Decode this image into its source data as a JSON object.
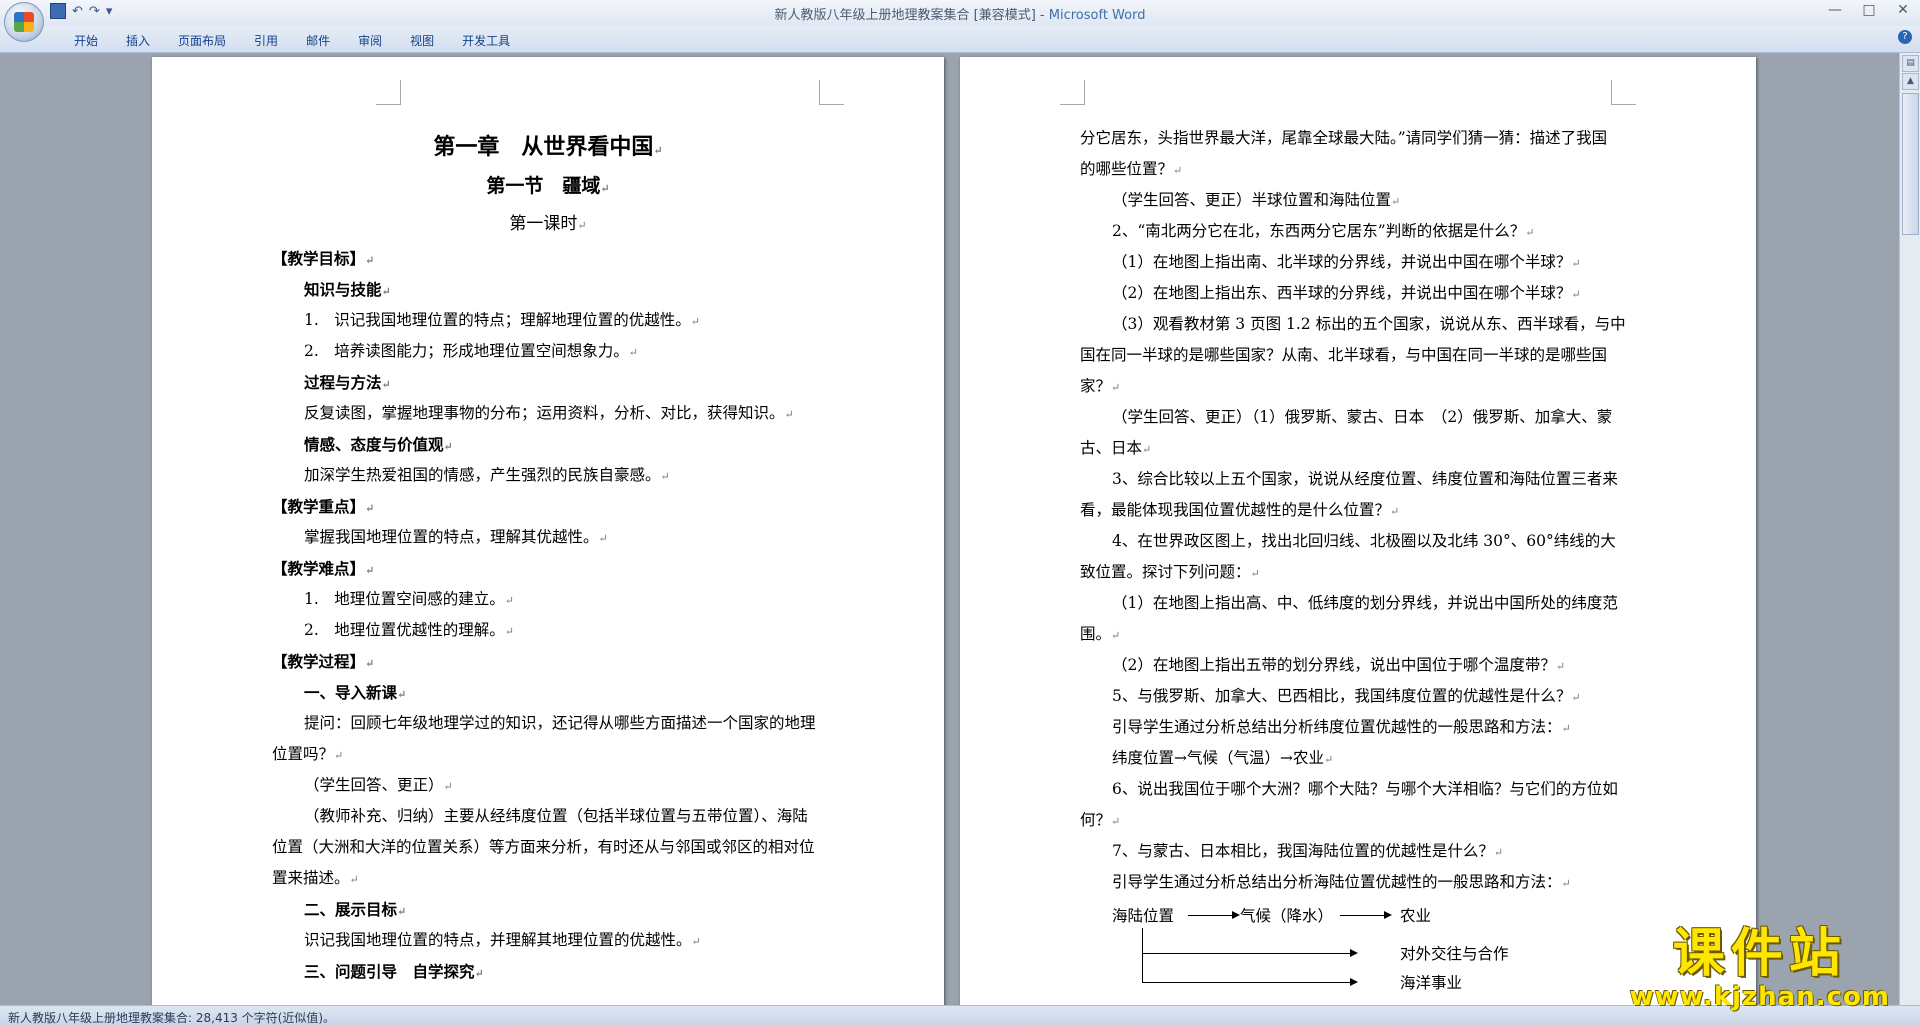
{
  "window": {
    "title": "新人教版八年级上册地理教案集合 [兼容模式] - ",
    "app_name": "Microsoft Word",
    "controls": [
      "—",
      "□",
      "✕"
    ]
  },
  "ribbon": {
    "tabs": [
      "开始",
      "插入",
      "页面布局",
      "引用",
      "邮件",
      "审阅",
      "视图",
      "开发工具"
    ]
  },
  "page_left": {
    "h1": "第一章　从世界看中国",
    "h2": "第一节　疆域",
    "h3": "第一课时",
    "lines": [
      "【教学目标】",
      "知识与技能",
      "1.　识记我国地理位置的特点；理解地理位置的优越性。",
      "2.　培养读图能力；形成地理位置空间想象力。",
      "过程与方法",
      "反复读图，掌握地理事物的分布；运用资料，分析、对比，获得知识。",
      "情感、态度与价值观",
      "加深学生热爱祖国的情感，产生强烈的民族自豪感。",
      "【教学重点】",
      "掌握我国地理位置的特点，理解其优越性。",
      "【教学难点】",
      "1.　地理位置空间感的建立。",
      "2.　地理位置优越性的理解。",
      "【教学过程】",
      "一、导入新课",
      "提问：回顾七年级地理学过的知识，还记得从哪些方面描述一个国家的地理",
      "位置吗？",
      "（学生回答、更正）",
      "（教师补充、归纳）主要从经纬度位置（包括半球位置与五带位置）、海陆",
      "位置（大洲和大洋的位置关系）等方面来分析，有时还从与邻国或邻区的相对位",
      "置来描述。",
      "二、展示目标",
      "识记我国地理位置的特点，并理解其地理位置的优越性。",
      "三、问题引导　自学探究"
    ]
  },
  "page_right": {
    "lines": [
      "分它居东，头指世界最大洋，尾靠全球最大陆。”请同学们猜一猜：描述了我国",
      "的哪些位置？",
      "（学生回答、更正）半球位置和海陆位置",
      "2、“南北两分它在北，东西两分它居东”判断的依据是什么？",
      "（1）在地图上指出南、北半球的分界线，并说出中国在哪个半球？",
      "（2）在地图上指出东、西半球的分界线，并说出中国在哪个半球？",
      "（3）观看教材第 3 页图 1.2 标出的五个国家，说说从东、西半球看，与中",
      "国在同一半球的是哪些国家？从南、北半球看，与中国在同一半球的是哪些国",
      "家？",
      "（学生回答、更正）（1）俄罗斯、蒙古、日本　（2）俄罗斯、加拿大、蒙",
      "古、日本",
      "3、综合比较以上五个国家，说说从经度位置、纬度位置和海陆位置三者来",
      "看，最能体现我国位置优越性的是什么位置？",
      "4、在世界政区图上，找出北回归线、北极圈以及北纬 30°、60°纬线的大",
      "致位置。探讨下列问题：",
      "（1）在地图上指出高、中、低纬度的划分界线，并说出中国所处的纬度范",
      "围。",
      "（2）在地图上指出五带的划分界线，说出中国位于哪个温度带？",
      "5、与俄罗斯、加拿大、巴西相比，我国纬度位置的优越性是什么？",
      "引导学生通过分析总结出分析纬度位置优越性的一般思路和方法：",
      "纬度位置→气候（气温）→农业",
      "6、说出我国位于哪个大洲？哪个大陆？与哪个大洋相临？与它们的方位如",
      "何？",
      "7、与蒙古、日本相比，我国海陆位置的优越性是什么？",
      "引导学生通过分析总结出分析海陆位置优越性的一般思路和方法："
    ],
    "flow": {
      "start": "海陆位置",
      "mid": "气候（降水）",
      "end1": "农业",
      "end2": "对外交往与合作",
      "end3": "海洋事业"
    }
  },
  "statusbar": {
    "text": "新人教版八年级上册地理教案集合: 28,413 个字符(近似值)。"
  },
  "watermark": {
    "cn": "课件站",
    "url": "www.kjzhan.com"
  }
}
